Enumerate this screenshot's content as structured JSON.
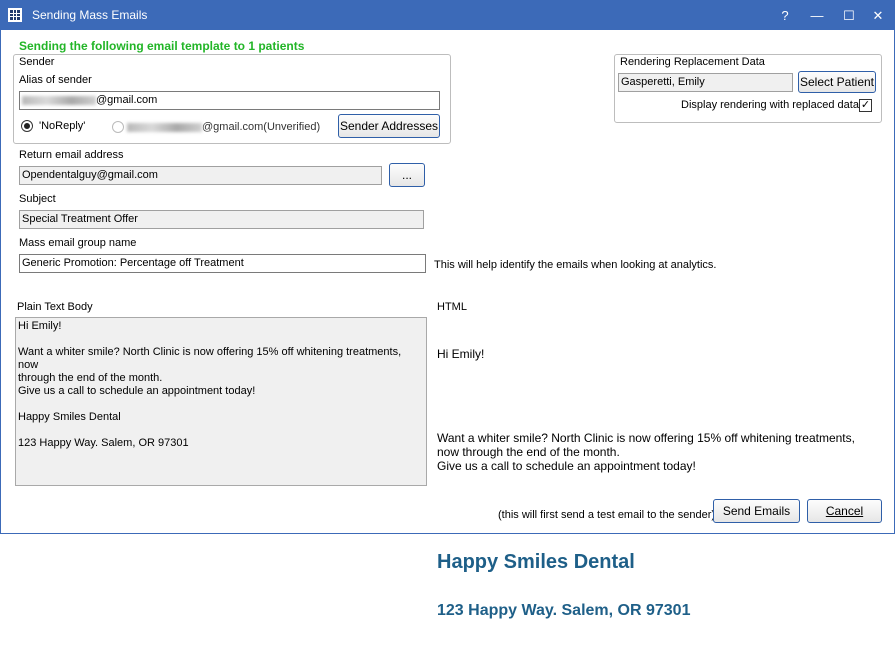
{
  "window": {
    "title": "Sending Mass Emails",
    "help_label": "?",
    "minimize_label": "—",
    "maximize_label": "☐",
    "close_label": "✕"
  },
  "header": {
    "message": "Sending the following email template to 1 patients"
  },
  "sender": {
    "group_label": "Sender",
    "alias_label": "Alias of sender",
    "alias_value_suffix": "@gmail.com",
    "noreply_label": "'NoReply'",
    "unverified_suffix": "@gmail.com(Unverified)",
    "addresses_button": "Sender Addresses"
  },
  "rendering": {
    "group_label": "Rendering Replacement Data",
    "patient_value": "Gasperetti, Emily",
    "select_patient_button": "Select Patient",
    "display_checkbox_label": "Display rendering with replaced data",
    "display_checked": true,
    "check_glyph": "✓"
  },
  "return_email": {
    "label": "Return email address",
    "value": "Opendentalguy@gmail.com",
    "browse_button": "..."
  },
  "subject": {
    "label": "Subject",
    "value": "Special Treatment Offer"
  },
  "group_name": {
    "label": "Mass email group name",
    "value": "Generic Promotion: Percentage off Treatment",
    "hint": "This will help identify the emails when looking at analytics."
  },
  "plain_body": {
    "label": "Plain Text Body",
    "text": "Hi Emily!\n\nWant a whiter smile? North Clinic is now offering 15% off whitening treatments, now\nthrough the end of the month.\nGive us a call to schedule an appointment today!\n\nHappy Smiles Dental\n\n123 Happy Way. Salem, OR 97301"
  },
  "html_body": {
    "label": "HTML",
    "greeting": "Hi Emily!",
    "paragraph": "Want a whiter smile? North Clinic is now offering 15% off whitening treatments,\nnow through the end of the month.\nGive us a call to schedule an appointment today!",
    "heading1": "Happy Smiles Dental",
    "heading2": "123 Happy Way. Salem, OR 97301"
  },
  "footer": {
    "note": "(this will first send a test email to the sender)",
    "send_button": "Send Emails",
    "cancel_button": "Cancel"
  }
}
